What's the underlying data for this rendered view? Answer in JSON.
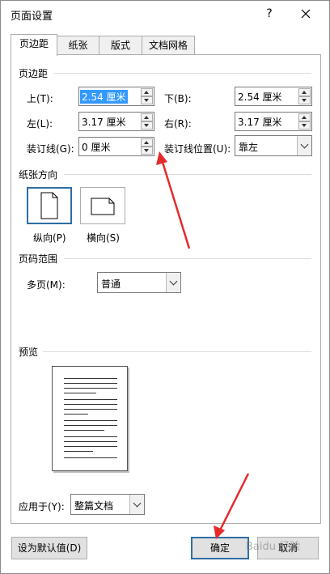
{
  "window": {
    "title": "页面设置",
    "help_label": "?"
  },
  "tabs": [
    {
      "label": "页边距",
      "active": true
    },
    {
      "label": "纸张",
      "active": false
    },
    {
      "label": "版式",
      "active": false
    },
    {
      "label": "文档网格",
      "active": false
    }
  ],
  "margins": {
    "section_label": "页边距",
    "top_label": "上(T):",
    "top_value": "2.54 厘米",
    "bottom_label": "下(B):",
    "bottom_value": "2.54 厘米",
    "left_label": "左(L):",
    "left_value": "3.17 厘米",
    "right_label": "右(R):",
    "right_value": "3.17 厘米",
    "gutter_label": "装订线(G):",
    "gutter_value": "0 厘米",
    "gutter_pos_label": "装订线位置(U):",
    "gutter_pos_value": "靠左"
  },
  "orientation": {
    "section_label": "纸张方向",
    "portrait_label": "纵向(P)",
    "landscape_label": "横向(S)",
    "selected": "portrait"
  },
  "pages": {
    "section_label": "页码范围",
    "multiple_label": "多页(M):",
    "multiple_value": "普通"
  },
  "preview": {
    "section_label": "预览"
  },
  "apply": {
    "label": "应用于(Y):",
    "value": "整篇文档"
  },
  "footer": {
    "default_label": "设为默认值(D)",
    "ok_label": "确定",
    "cancel_label": "取消"
  },
  "watermark": "Baidu 经验",
  "colors": {
    "accent": "#2e6da4",
    "arrow": "#e52b2b",
    "selection": "#3399ff"
  }
}
